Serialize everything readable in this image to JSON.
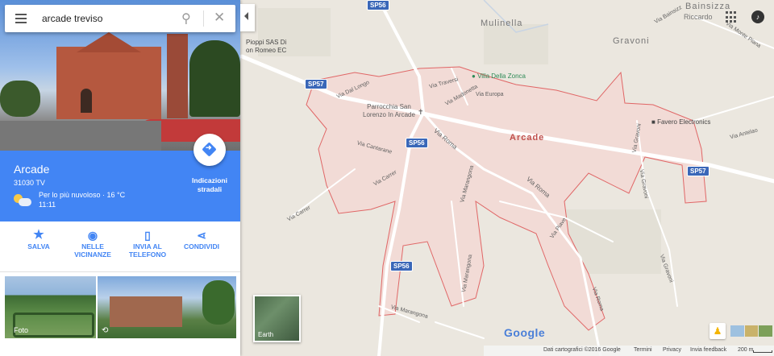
{
  "search": {
    "query": "arcade treviso"
  },
  "place": {
    "name": "Arcade",
    "postal": "31030 TV",
    "weather_desc": "Per lo più nuvoloso · 16 °C",
    "weather_time": "11:11",
    "directions_label_1": "Indicazioni",
    "directions_label_2": "stradali"
  },
  "actions": [
    {
      "label_1": "SALVA",
      "label_2": ""
    },
    {
      "label_1": "NELLE",
      "label_2": "VICINANZE"
    },
    {
      "label_1": "INVIA AL",
      "label_2": "TELEFONO"
    },
    {
      "label_1": "CONDIVIDI",
      "label_2": ""
    }
  ],
  "photos": {
    "photo_label": "Foto"
  },
  "map": {
    "town_label": "Arcade",
    "area_labels": {
      "mulinella": "Mulinella",
      "gravoni": "Gravoni",
      "bainsizza": "Bainsizza",
      "riccardo": "Riccardo"
    },
    "poi": {
      "villa": "Villa Della Zonca",
      "parrocchia_1": "Parrocchia San",
      "parrocchia_2": "Lorenzo In Arcade",
      "favero": "Favero Electronics",
      "pioppi_1": "Pioppi SAS Di",
      "pioppi_2": "on Romeo EC"
    },
    "streets": {
      "via_traversi": "Via Traversi",
      "via_madonetta": "Via Madonetta",
      "via_europa": "Via Europa",
      "via_dal_longo": "Via Dal Longo",
      "via_roma": "Via Roma",
      "via_cantarane": "Via Cantarane",
      "via_carrer": "Via Carrer",
      "via_marangona": "Via Marangona",
      "via_piave": "Via Piave",
      "via_antelao": "Via Antelao",
      "via_gravoni": "Via Gravoni",
      "via_bainsizza": "Via Bainsizz",
      "via_monte_piana": "Via Monte Piana"
    },
    "road_shields": {
      "sp56": "SP56",
      "sp57": "SP57"
    },
    "earth_label": "Earth",
    "google_logo": "Google"
  },
  "footer": {
    "data": "Dati cartografici ©2016 Google",
    "terms": "Termini",
    "privacy": "Privacy",
    "feedback": "Invia feedback",
    "scale": "200 m"
  },
  "colors": {
    "accent": "#4285f4",
    "boundary": "#e06666",
    "boundary_fill": "#f4dcd8"
  }
}
